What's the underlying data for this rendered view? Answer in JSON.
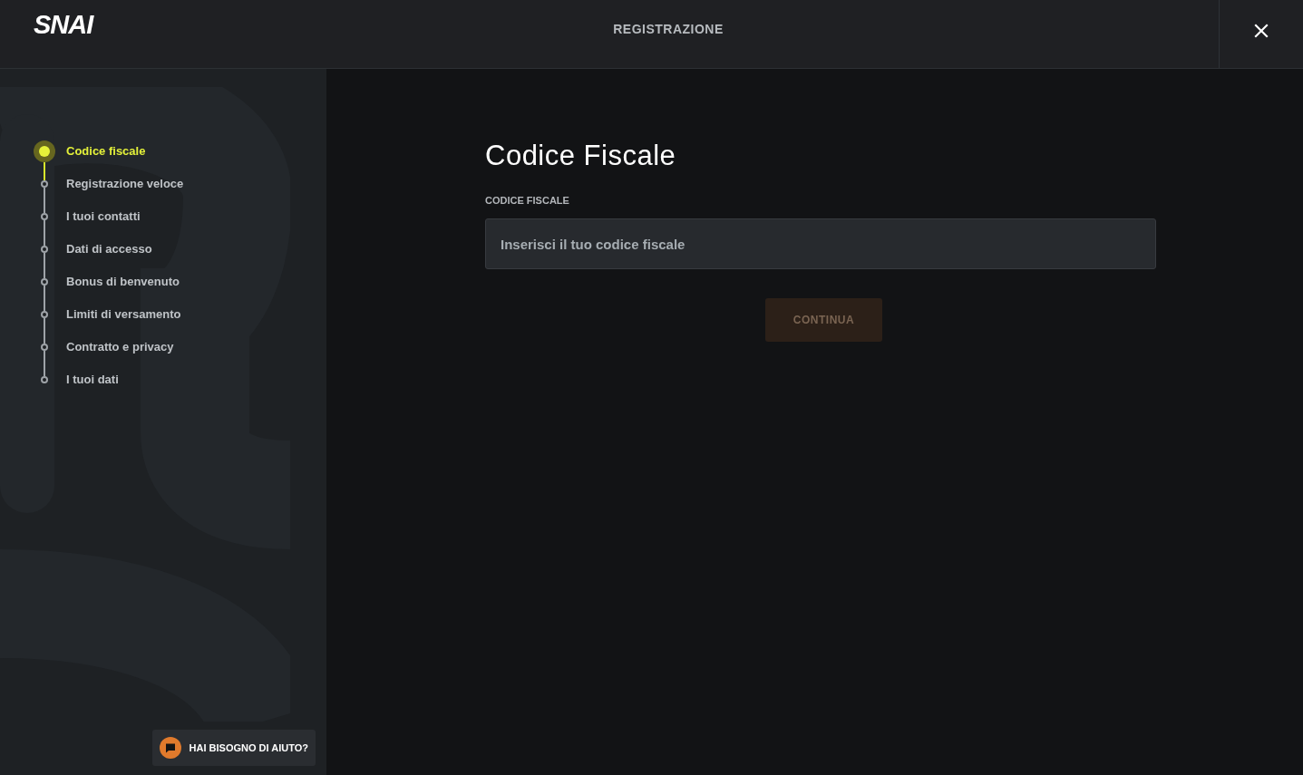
{
  "header": {
    "logo": "SNAI",
    "title": "REGISTRAZIONE"
  },
  "steps": [
    {
      "label": "Codice fiscale",
      "selected": true
    },
    {
      "label": "Registrazione veloce",
      "selected": false
    },
    {
      "label": "I tuoi contatti",
      "selected": false
    },
    {
      "label": "Dati di accesso",
      "selected": false
    },
    {
      "label": "Bonus di benvenuto",
      "selected": false
    },
    {
      "label": "Limiti di versamento",
      "selected": false
    },
    {
      "label": "Contratto e privacy",
      "selected": false
    },
    {
      "label": "I tuoi dati",
      "selected": false
    }
  ],
  "form": {
    "title": "Codice Fiscale",
    "field_label": "CODICE FISCALE",
    "field": {
      "placeholder": "Inserisci il tuo codice fiscale"
    },
    "submit": {
      "label": "CONTINUA",
      "disabled": true
    }
  },
  "help_button": {
    "label": "HAI BISOGNO DI AIUTO?"
  }
}
